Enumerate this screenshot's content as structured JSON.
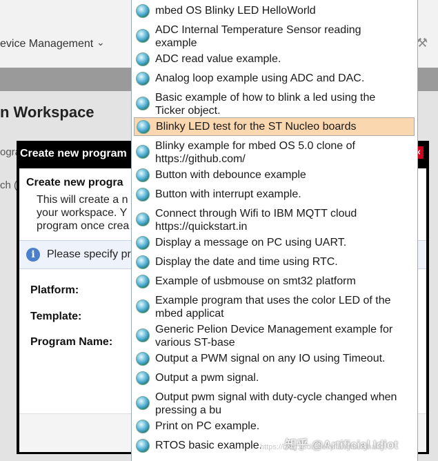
{
  "background": {
    "nav_item": "evice Management",
    "workspace_title": "n Workspace",
    "fragments": [
      "ogra",
      "ch ("
    ]
  },
  "dialog": {
    "title": "Create new program",
    "heading": "Create new progra",
    "desc_lines": [
      "This will create a n",
      "your workspace. Y",
      "program once crea"
    ],
    "info": "Please specify pr",
    "labels": {
      "platform": "Platform:",
      "template": "Template:",
      "program_name": "Program Name:"
    }
  },
  "dropdown": {
    "items": [
      {
        "lines": [
          "mbed OS Blinky LED HelloWorld"
        ]
      },
      {
        "lines": [
          "ADC Internal Temperature Sensor reading",
          "example"
        ]
      },
      {
        "lines": [
          "ADC read value example."
        ]
      },
      {
        "lines": [
          "Analog loop example using ADC and DAC."
        ]
      },
      {
        "lines": [
          "Basic example of how to blink a led using the",
          "Ticker object."
        ]
      },
      {
        "lines": [
          "Blinky LED test for the ST Nucleo boards"
        ],
        "selected": true
      },
      {
        "lines": [
          "Blinky example for mbed OS 5.0 clone of",
          "https://github.com/"
        ]
      },
      {
        "lines": [
          "Button with debounce example"
        ]
      },
      {
        "lines": [
          "Button with interrupt example."
        ]
      },
      {
        "lines": [
          "Connect through Wifi to IBM MQTT cloud",
          "https://quickstart.in"
        ]
      },
      {
        "lines": [
          "Display a message on PC using UART."
        ]
      },
      {
        "lines": [
          "Display the date and time using RTC."
        ]
      },
      {
        "lines": [
          "Example of usbmouse on smt32 platform"
        ]
      },
      {
        "lines": [
          "Example program that uses the color LED of the",
          "mbed applicat"
        ]
      },
      {
        "lines": [
          "Generic Pelion Device Management example for",
          "various ST-base"
        ]
      },
      {
        "lines": [
          "Output a PWM signal on any IO using Timeout."
        ]
      },
      {
        "lines": [
          "Output a pwm signal."
        ]
      },
      {
        "lines": [
          "Output pwm signal with duty-cycle changed when",
          "pressing a bu"
        ]
      },
      {
        "lines": [
          "Print on PC example."
        ]
      },
      {
        "lines": [
          "RTOS basic example."
        ]
      }
    ]
  },
  "watermark": {
    "text": "知乎 @Artificial Idiot",
    "url": "https://blog.csdn.net/yifanghanghang"
  }
}
